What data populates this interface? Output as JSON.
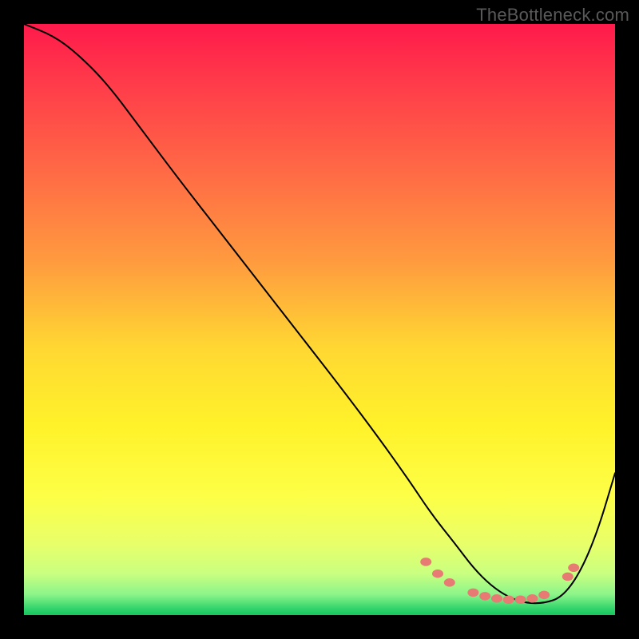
{
  "attribution": "TheBottleneck.com",
  "chart_data": {
    "type": "line",
    "title": "",
    "xlabel": "",
    "ylabel": "",
    "xlim": [
      0,
      100
    ],
    "ylim": [
      0,
      100
    ],
    "grid": false,
    "legend": false,
    "background_gradient": {
      "stops": [
        {
          "offset": 0.0,
          "color": "#ff1a4b"
        },
        {
          "offset": 0.1,
          "color": "#ff3b4a"
        },
        {
          "offset": 0.25,
          "color": "#ff6a45"
        },
        {
          "offset": 0.4,
          "color": "#ff9a3f"
        },
        {
          "offset": 0.55,
          "color": "#ffd832"
        },
        {
          "offset": 0.68,
          "color": "#fff22a"
        },
        {
          "offset": 0.8,
          "color": "#fdff47"
        },
        {
          "offset": 0.88,
          "color": "#e8ff6a"
        },
        {
          "offset": 0.93,
          "color": "#c9ff80"
        },
        {
          "offset": 0.965,
          "color": "#8cf58a"
        },
        {
          "offset": 0.99,
          "color": "#2fd36b"
        },
        {
          "offset": 1.0,
          "color": "#17c55e"
        }
      ]
    },
    "series": [
      {
        "name": "bottleneck-curve",
        "color": "#000000",
        "stroke_width": 2,
        "x": [
          0,
          5,
          9,
          14,
          20,
          26,
          33,
          40,
          47,
          54,
          60,
          65,
          69,
          73,
          76,
          79,
          82,
          85,
          88,
          91,
          94,
          97,
          100
        ],
        "y": [
          100,
          98,
          95,
          90,
          82,
          74,
          65,
          56,
          47,
          38,
          30,
          23,
          17,
          12,
          8,
          5,
          3,
          2,
          2,
          3,
          7,
          14,
          24
        ]
      }
    ],
    "markers": {
      "name": "highlight-points",
      "color": "#e77b73",
      "radius": 7,
      "points": [
        {
          "x": 68,
          "y": 9.0
        },
        {
          "x": 70,
          "y": 7.0
        },
        {
          "x": 72,
          "y": 5.5
        },
        {
          "x": 76,
          "y": 3.8
        },
        {
          "x": 78,
          "y": 3.2
        },
        {
          "x": 80,
          "y": 2.8
        },
        {
          "x": 82,
          "y": 2.6
        },
        {
          "x": 84,
          "y": 2.6
        },
        {
          "x": 86,
          "y": 2.8
        },
        {
          "x": 88,
          "y": 3.4
        },
        {
          "x": 92,
          "y": 6.5
        },
        {
          "x": 93,
          "y": 8.0
        }
      ]
    }
  }
}
